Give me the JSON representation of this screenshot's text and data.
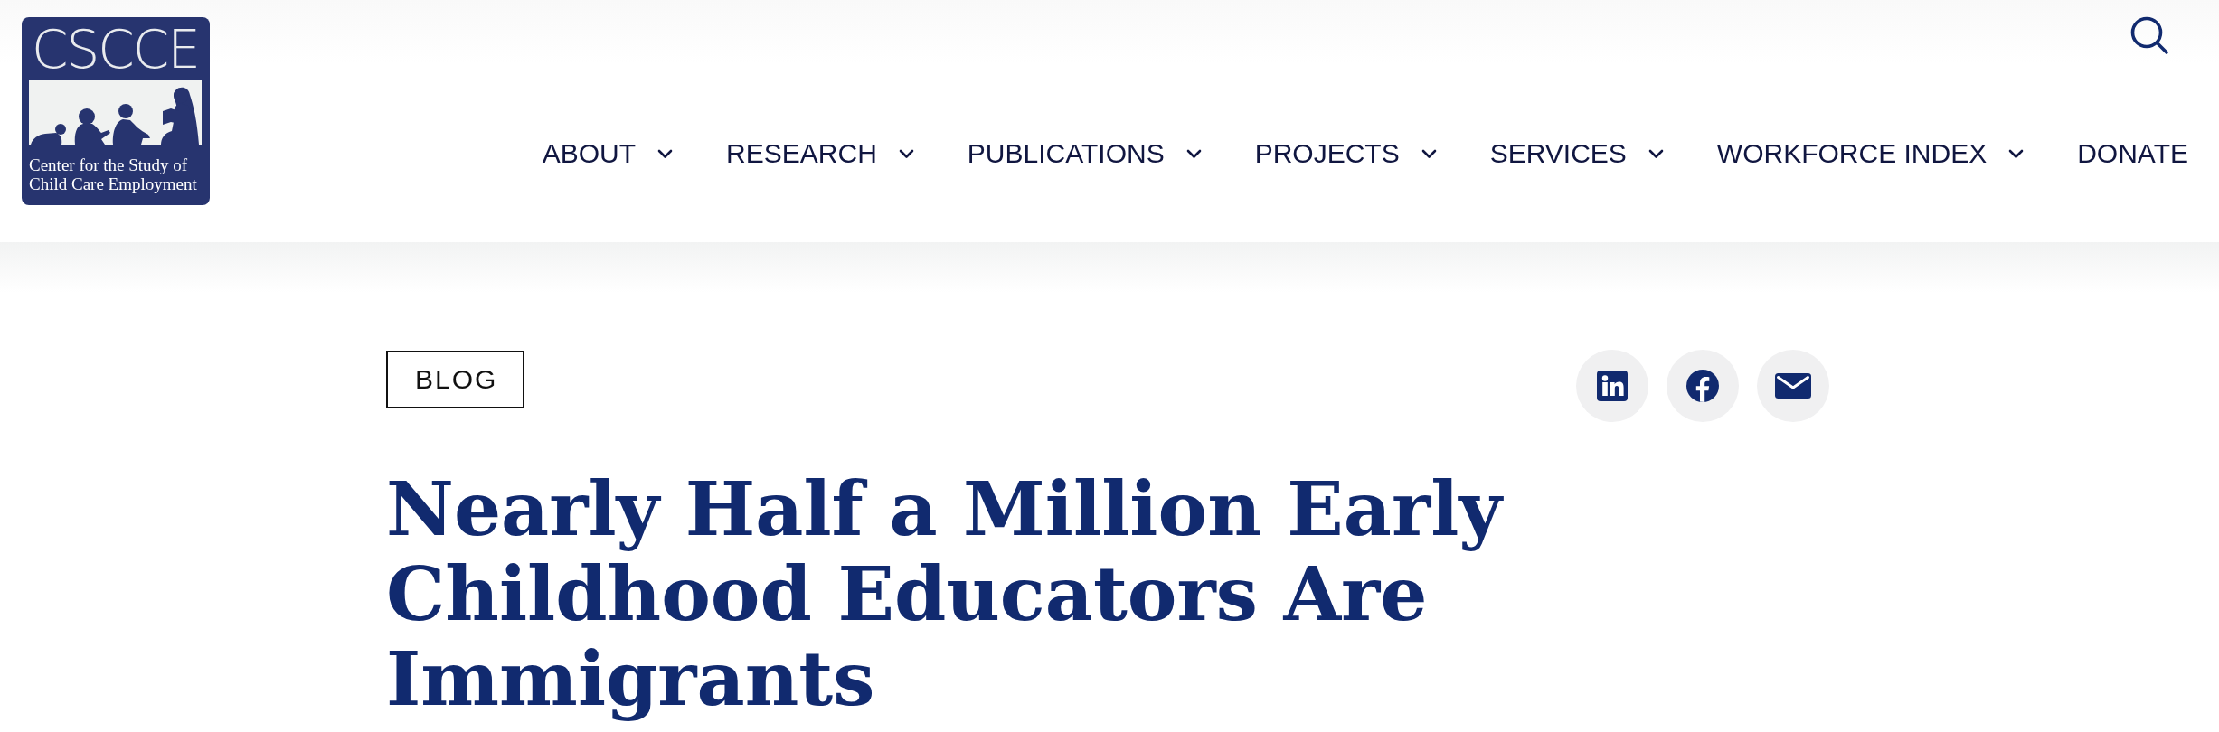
{
  "header": {
    "logo": {
      "acronym": "CSCCE",
      "caption": "Center for the Study of Child Care Employment"
    },
    "nav": [
      {
        "label": "ABOUT",
        "has_menu": true
      },
      {
        "label": "RESEARCH",
        "has_menu": true
      },
      {
        "label": "PUBLICATIONS",
        "has_menu": true
      },
      {
        "label": "PROJECTS",
        "has_menu": true
      },
      {
        "label": "SERVICES",
        "has_menu": true
      },
      {
        "label": "WORKFORCE INDEX",
        "has_menu": true
      },
      {
        "label": "DONATE",
        "has_menu": false
      }
    ]
  },
  "article": {
    "category": "BLOG",
    "share_buttons": [
      {
        "kind": "linkedin"
      },
      {
        "kind": "facebook"
      },
      {
        "kind": "email"
      }
    ],
    "title": "Nearly Half a Million Early Childhood Educators Are Immigrants"
  }
}
